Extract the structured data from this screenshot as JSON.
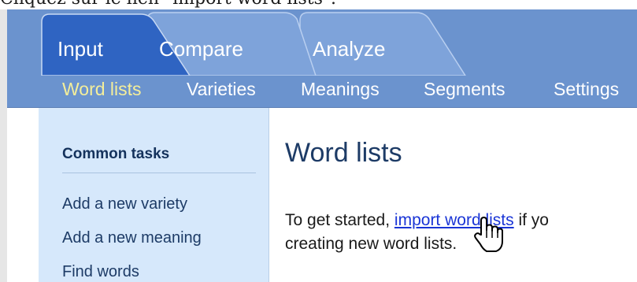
{
  "instruction": "Cliquez sur le lien \"import word lists\".",
  "tabs": [
    {
      "label": "Input",
      "active": true
    },
    {
      "label": "Compare",
      "active": false
    },
    {
      "label": "Analyze",
      "active": false
    }
  ],
  "subnav": [
    {
      "label": "Word lists",
      "active": true
    },
    {
      "label": "Varieties",
      "active": false
    },
    {
      "label": "Meanings",
      "active": false
    },
    {
      "label": "Segments",
      "active": false
    },
    {
      "label": "Settings",
      "active": false
    }
  ],
  "sidebar": {
    "heading": "Common tasks",
    "links": [
      "Add a new variety",
      "Add a new meaning",
      "Find words"
    ]
  },
  "main": {
    "title": "Word lists",
    "text_before_link": "To get started, ",
    "link_text": "import word lists",
    "text_after_link": " if yo",
    "line2": "creating new word lists."
  },
  "colors": {
    "ribbon": "#6b93ce",
    "active_tab": "#2f64c2",
    "inactive_tab": "#7ea3da",
    "active_subnav": "#f4ee9a",
    "sidebar": "#d6e8fb",
    "link": "#1a35d6"
  },
  "icons": {
    "cursor": "hand-pointer-icon"
  }
}
